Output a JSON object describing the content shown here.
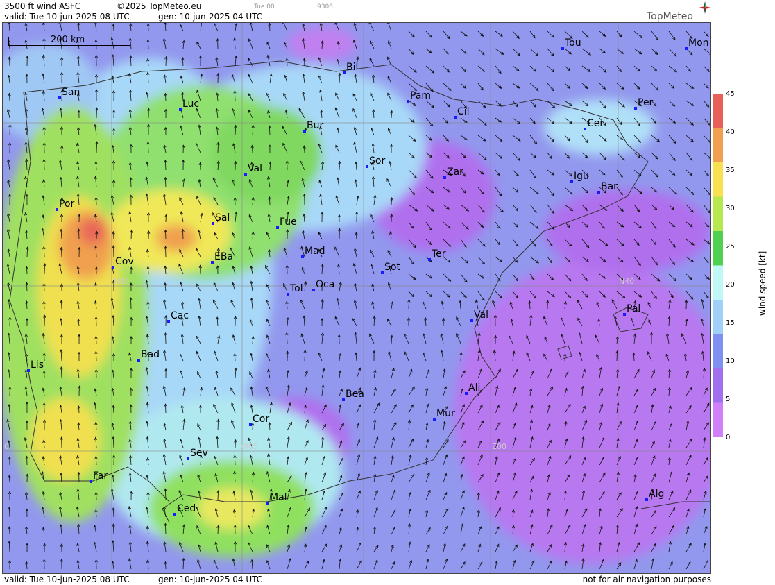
{
  "header": {
    "product": "3500 ft wind ASFC",
    "copyright": "©2025 TopMeteo.eu",
    "valid": "valid:  Tue  10-jun-2025  08 UTC",
    "gen": "gen: 10-jun-2025 04 UTC",
    "tab": "Tue 00",
    "code": "9306"
  },
  "footer": {
    "valid": "valid:  Tue  10-jun-2025  08 UTC",
    "gen": "gen: 10-jun-2025 04 UTC",
    "note": "not for air navigation purposes"
  },
  "logo": {
    "text": "TopMeteo",
    "icon": "compass-icon"
  },
  "scalebar": {
    "label": "200 km"
  },
  "legend": {
    "title": "wind speed  [kt]",
    "ticks": [
      "45",
      "40",
      "35",
      "30",
      "25",
      "20",
      "15",
      "10",
      "5",
      "0"
    ],
    "colors": [
      "#e8605a",
      "#f0a050",
      "#f8e050",
      "#b8e850",
      "#50d050",
      "#c0f8f8",
      "#a0d0f8",
      "#8090f0",
      "#a070f0",
      "#d080f8"
    ]
  },
  "grid_labels": {
    "lat": "N40",
    "lat2": "N40",
    "lon1": "W05",
    "lon2": "E00",
    "lon0": "0"
  },
  "cities": [
    {
      "name": "San"
    },
    {
      "name": "Luc"
    },
    {
      "name": "Bil"
    },
    {
      "name": "Pam"
    },
    {
      "name": "Tou"
    },
    {
      "name": "Mon"
    },
    {
      "name": "Cil"
    },
    {
      "name": "Per"
    },
    {
      "name": "Cer"
    },
    {
      "name": "Bur"
    },
    {
      "name": "Sor"
    },
    {
      "name": "Zar"
    },
    {
      "name": "Igu"
    },
    {
      "name": "Bar"
    },
    {
      "name": "Val"
    },
    {
      "name": "Por"
    },
    {
      "name": "Sal"
    },
    {
      "name": "Fue"
    },
    {
      "name": "Cov"
    },
    {
      "name": "EBa"
    },
    {
      "name": "Mad"
    },
    {
      "name": "Ter"
    },
    {
      "name": "Sot"
    },
    {
      "name": "Tol"
    },
    {
      "name": "Oca"
    },
    {
      "name": "Val"
    },
    {
      "name": "Pal"
    },
    {
      "name": "Cac"
    },
    {
      "name": "Bad"
    },
    {
      "name": "Lis"
    },
    {
      "name": "Bea"
    },
    {
      "name": "Ali"
    },
    {
      "name": "Cor"
    },
    {
      "name": "Mur"
    },
    {
      "name": "Sev"
    },
    {
      "name": "Far"
    },
    {
      "name": "Mal"
    },
    {
      "name": "Ced"
    },
    {
      "name": "Alg"
    }
  ]
}
